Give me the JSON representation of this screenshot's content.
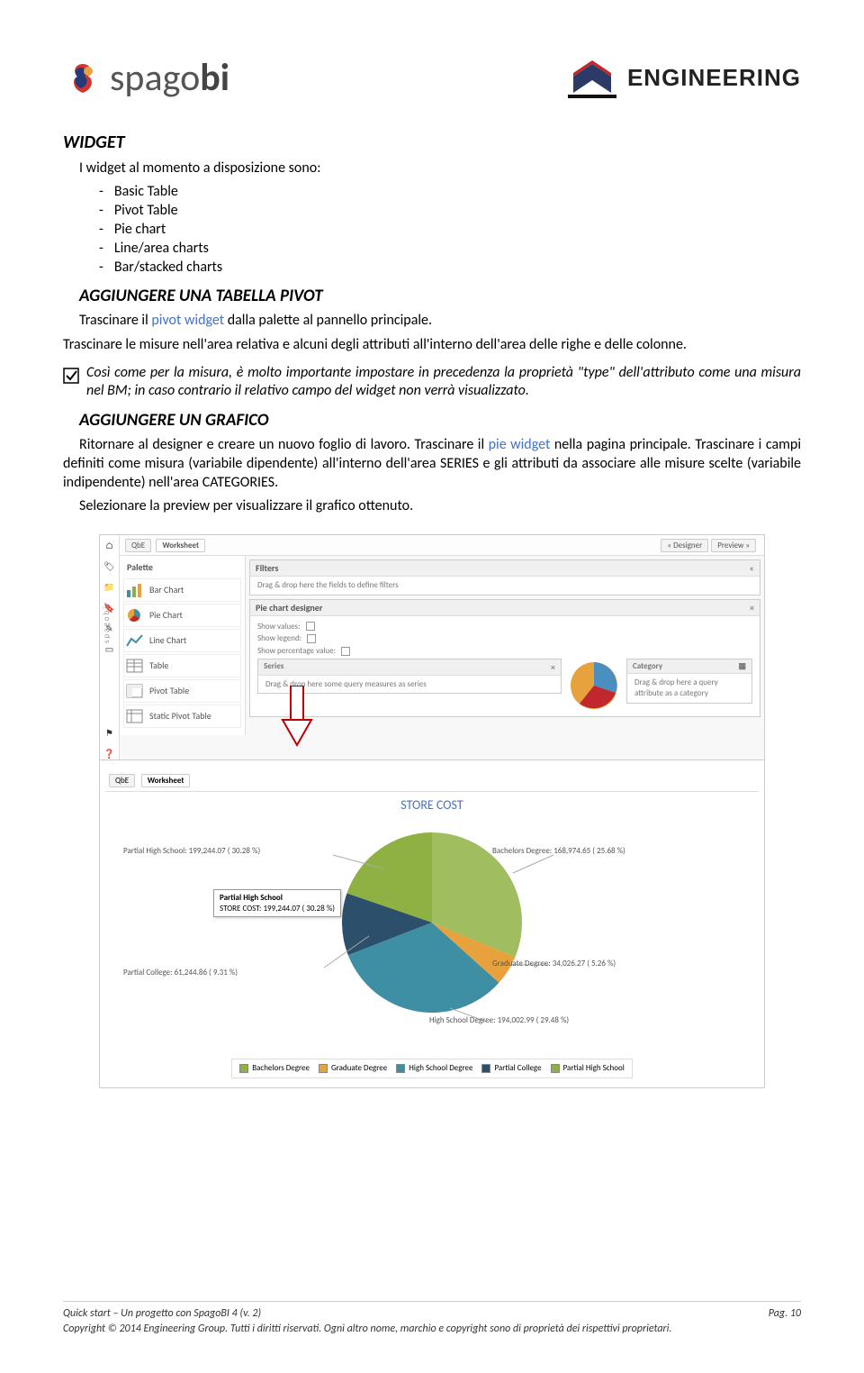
{
  "header": {
    "logo1_text_light": "spago",
    "logo1_text_bold": "bi",
    "logo2_text": "ENGINEERING"
  },
  "sections": {
    "widget_h": "WIDGET",
    "widget_intro": "I widget al momento a disposizione sono:",
    "widget_list": [
      "Basic Table",
      "Pivot  Table",
      "Pie chart",
      "Line/area charts",
      "Bar/stacked charts"
    ],
    "add_pivot_h": "AGGIUNGERE UNA TABELLA PIVOT",
    "pivot_p1_a": "Trascinare il ",
    "pivot_p1_link": "pivot widget",
    "pivot_p1_b": " dalla palette al pannello principale.",
    "pivot_p2": "Trascinare le misure nell'area relativa e alcuni degli attributi all'interno dell'area delle righe e delle colonne.",
    "note_text": "Così come per la misura, è molto importante impostare in precedenza la proprietà \"type\" dell'attributo come una misura nel BM; in caso contrario il relativo campo del widget non verrà visualizzato.",
    "add_chart_h": "AGGIUNGERE UN GRAFICO",
    "chart_p1_a": "Ritornare al designer e creare un nuovo foglio di lavoro. Trascinare il ",
    "chart_p1_link": "pie widget",
    "chart_p1_b": " nella pagina principale. Trascinare i campi definiti come misura (variabile dipendente) all'interno dell'area SERIES e gli attributi da associare alle misure scelte (variabile indipendente) nell'area CATEGORIES.",
    "chart_p2": "Selezionare la preview per visualizzare il grafico ottenuto."
  },
  "designer": {
    "tab_qbe": "QbE",
    "tab_worksheet": "Worksheet",
    "btn_designer": "« Designer",
    "btn_preview": "Preview »",
    "palette_header": "Palette",
    "palette_items": [
      "Bar Chart",
      "Pie Chart",
      "Line Chart",
      "Table",
      "Pivot Table",
      "Static Pivot Table"
    ],
    "filters_title": "Filters",
    "filters_hint": "Drag & drop here the fields to define filters",
    "pie_designer_title": "Pie chart designer",
    "opt_show_values": "Show values:",
    "opt_show_legend": "Show legend:",
    "opt_show_pct": "Show percentage value:",
    "series_title": "Series",
    "series_hint": "Drag & drop here some query measures as series",
    "category_title": "Category",
    "category_hint": "Drag & drop here a query attribute as a category",
    "vertical_brand": "spagobi"
  },
  "chart_data": {
    "type": "pie",
    "title": "STORE COST",
    "series": [
      {
        "name": "Bachelors Degree",
        "value": 168974.65,
        "pct": 25.68,
        "color": "#8FB143"
      },
      {
        "name": "Graduate Degree",
        "value": 34026.27,
        "pct": 5.26,
        "color": "#E8A23D"
      },
      {
        "name": "High School Degree",
        "value": 194002.99,
        "pct": 29.48,
        "color": "#3E8FA3"
      },
      {
        "name": "Partial College",
        "value": 61244.86,
        "pct": 9.31,
        "color": "#2C4F6B"
      },
      {
        "name": "Partial High School",
        "value": 199244.07,
        "pct": 30.28,
        "color": "#8FB143"
      }
    ],
    "tooltip": {
      "line1": "Partial High School",
      "line2": "STORE COST: 199,244.07 ( 30.28 %)"
    },
    "callouts": {
      "bachelors": "Bachelors Degree: 168,974.65 ( 25.68 %)",
      "graduate": "Graduate Degree: 34,026.27 ( 5.26 %)",
      "highschool": "High School Degree: 194,002.99 ( 29.48 %)",
      "partialcollege": "Partial College: 61,244.86 ( 9.31 %)",
      "partialhs": "Partial High School: 199,244.07 ( 30.28 %)"
    }
  },
  "footer": {
    "doc_title": "Quick start – Un progetto con SpagoBI 4 (v. 2)",
    "page_num": "Pag. 10",
    "copyright": "Copyright © 2014  Engineering Group. Tutti i diritti riservati. Ogni altro nome, marchio e copyright sono di proprietà dei rispettivi proprietari."
  }
}
